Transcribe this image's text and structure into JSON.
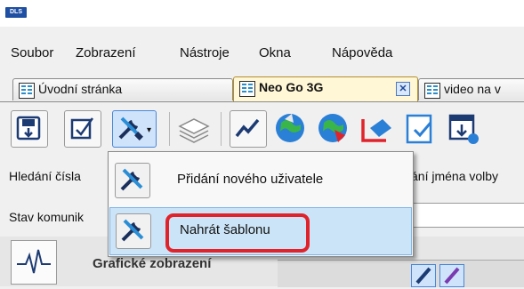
{
  "app": {
    "logo_text": "DLS"
  },
  "menubar": {
    "items": [
      "Soubor",
      "Zobrazení",
      "Nástroje",
      "Okna",
      "Nápověda"
    ]
  },
  "tabs": [
    {
      "label": "Úvodní stránka"
    },
    {
      "label": "Neo Go 3G",
      "close": "✕"
    },
    {
      "label": "video na v"
    }
  ],
  "toolbar": {
    "buttons": [
      "save-icon",
      "checkbox-icon",
      "tools-icon",
      "stacked-pages-icon",
      "line-chart-icon",
      "globe-up-icon",
      "globe-down-icon",
      "export-icon",
      "document-check-icon",
      "download-window-icon"
    ]
  },
  "form": {
    "search_number_label": "Hledání čísla",
    "search_name_label": "ání jména volby",
    "status_label": "Stav komunik"
  },
  "panel": {
    "graphic_view_label": "Grafické zobrazení"
  },
  "dropdown": {
    "items": [
      {
        "label": "Přidání nového uživatele",
        "icon": "tools-icon"
      },
      {
        "label": "Nahrát šablonu",
        "icon": "tools-icon"
      }
    ]
  },
  "colors": {
    "highlight": "#e0232b",
    "menu_hover": "#cce4f7"
  }
}
